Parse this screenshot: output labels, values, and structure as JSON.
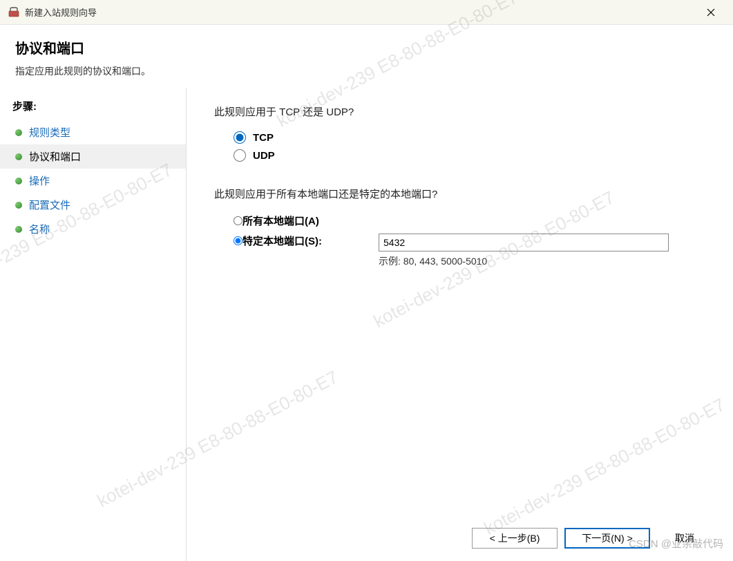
{
  "titlebar": {
    "title": "新建入站规则向导"
  },
  "header": {
    "title": "协议和端口",
    "subtitle": "指定应用此规则的协议和端口。"
  },
  "sidebar": {
    "header": "步骤:",
    "items": [
      {
        "label": "规则类型"
      },
      {
        "label": "协议和端口"
      },
      {
        "label": "操作"
      },
      {
        "label": "配置文件"
      },
      {
        "label": "名称"
      }
    ]
  },
  "main": {
    "protocol_question": "此规则应用于 TCP 还是 UDP?",
    "tcp_label": "TCP",
    "udp_label": "UDP",
    "port_question": "此规则应用于所有本地端口还是特定的本地端口?",
    "all_ports_label": "所有本地端口(A)",
    "specific_ports_label": "特定本地端口(S):",
    "port_value": "5432",
    "port_example": "示例: 80, 443, 5000-5010"
  },
  "footer": {
    "back": "< 上一步(B)",
    "next": "下一页(N) >",
    "cancel": "取消"
  },
  "watermark": {
    "text": "kotei-dev-239  E8-80-88-E0-80-E7",
    "csdn": "CSDN @业余敲代码"
  }
}
